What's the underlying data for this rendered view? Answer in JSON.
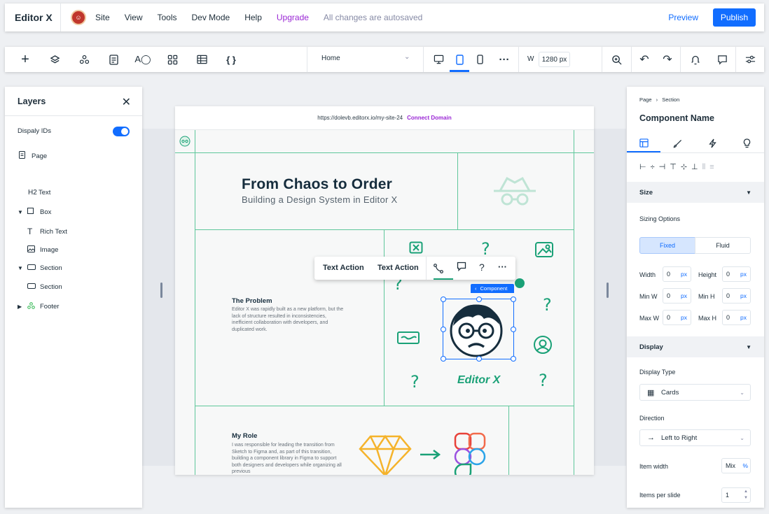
{
  "topbar": {
    "logo": "Editor X",
    "avatar_icon": "user-avatar",
    "menu": [
      "Site",
      "View",
      "Tools",
      "Dev Mode",
      "Help",
      "Upgrade"
    ],
    "autosave": "All changes are autosaved",
    "preview": "Preview",
    "publish": "Publish"
  },
  "toolbar": {
    "page": "Home",
    "width_label": "W",
    "width_value": "1280 px"
  },
  "layers": {
    "title": "Layers",
    "display_ids_label": "Dispaly IDs",
    "display_ids_on": true,
    "items": [
      {
        "label": "Page",
        "icon": "page-icon",
        "prefix": ""
      },
      {
        "label": "Text",
        "icon": "h2-icon",
        "prefix": "H2"
      },
      {
        "label": "Box",
        "icon": "box-icon",
        "prefix": ""
      },
      {
        "label": "Rich Text",
        "icon": "text-icon",
        "prefix": ""
      },
      {
        "label": "Image",
        "icon": "image-icon",
        "prefix": ""
      },
      {
        "label": "Section",
        "icon": "section-icon",
        "prefix": ""
      },
      {
        "label": "Section",
        "icon": "section-icon",
        "prefix": ""
      },
      {
        "label": "Footer",
        "icon": "component-icon",
        "prefix": ""
      }
    ]
  },
  "site": {
    "url": "https://dolevb.editorx.io/my-site-24",
    "connect": "Connect Domain",
    "hero_title": "From Chaos to Order",
    "hero_sub": "Building a Design System in Editor X",
    "problem_title": "The Problem",
    "problem_body": "Editor X was rapidly built as a new platform, but the lack of structure resulted in inconsistencies, inefficient collaboration with developers, and duplicated work.",
    "role_title": "My Role",
    "role_body": "I was responsible for leading the transition from Sketch to Figma and, as part of this transition, building a component library in Figma to support both designers and developers while organizing all previous",
    "illustration_text": "Editor X"
  },
  "actionbar": {
    "action1": "Text Action",
    "action2": "Text Action",
    "component_tag": "Component"
  },
  "props": {
    "crumb_page": "Page",
    "crumb_section": "Section",
    "component_name": "Component Name",
    "size_header": "Size",
    "sizing_options": "Sizing Options",
    "fixed": "Fixed",
    "fluid": "Fluid",
    "width_label": "Width",
    "height_label": "Height",
    "minw_label": "Min W",
    "minh_label": "Min H",
    "maxw_label": "Max W",
    "maxh_label": "Max H",
    "zero": "0",
    "px": "px",
    "display_header": "Display",
    "display_type_label": "Display Type",
    "display_type": "Cards",
    "direction_label": "Direction",
    "direction": "Left to Right",
    "item_width_label": "Item width",
    "item_width": "Mix",
    "item_width_unit": "%",
    "items_per_slide_label": "Items per slide",
    "items_per_slide": "1"
  },
  "colors": {
    "accent": "#116dff",
    "upgrade": "#9a27d5",
    "grid": "#5fc79b",
    "illustration": "#1aa177"
  }
}
